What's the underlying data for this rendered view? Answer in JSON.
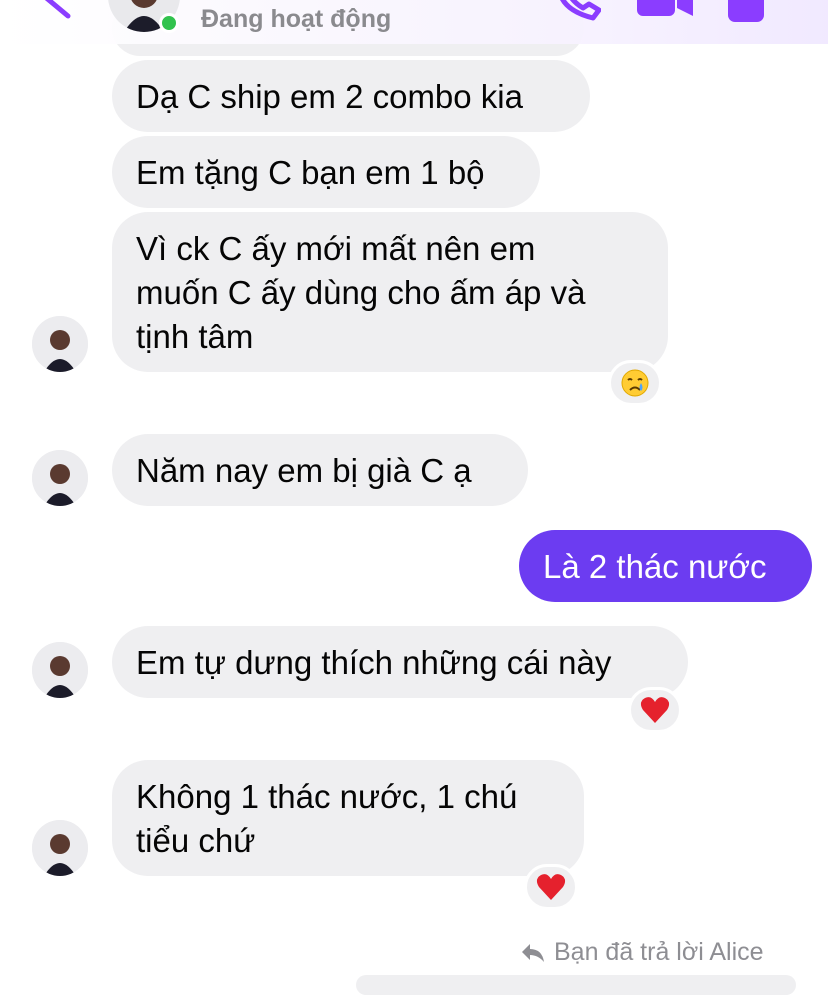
{
  "header": {
    "status": "Đang hoạt động",
    "accent_color": "#8b3dff",
    "online_color": "#31c24d"
  },
  "messages": [
    {
      "direction": "in",
      "lines": [
        "Dạ C ship em 2 combo kia"
      ]
    },
    {
      "direction": "in",
      "lines": [
        "Em tặng C bạn em 1 bộ"
      ]
    },
    {
      "direction": "in",
      "lines": [
        "Vì ck C ấy mới mất nên em",
        "muốn C ấy dùng cho ấm áp và",
        "tịnh tâm"
      ],
      "reaction": "crying-face"
    },
    {
      "direction": "in",
      "lines": [
        "Năm nay em bị già C ạ"
      ]
    },
    {
      "direction": "out",
      "lines": [
        "Là 2 thác nước"
      ]
    },
    {
      "direction": "in",
      "lines": [
        "Em tự dưng thích những cái này"
      ],
      "reaction": "red-heart"
    },
    {
      "direction": "in",
      "lines": [
        "Không 1 thác nước, 1 chú",
        "tiểu chứ"
      ],
      "reaction": "red-heart"
    }
  ],
  "reply_note": "Bạn đã trả lời Alice",
  "icons": {
    "back": "chevron-left-icon",
    "call": "phone-icon",
    "video": "video-camera-icon",
    "info": "info-icon",
    "reply": "reply-arrow-icon"
  },
  "colors": {
    "incoming_bubble": "#efeff1",
    "outgoing_bubble": "#6c3cf1"
  }
}
